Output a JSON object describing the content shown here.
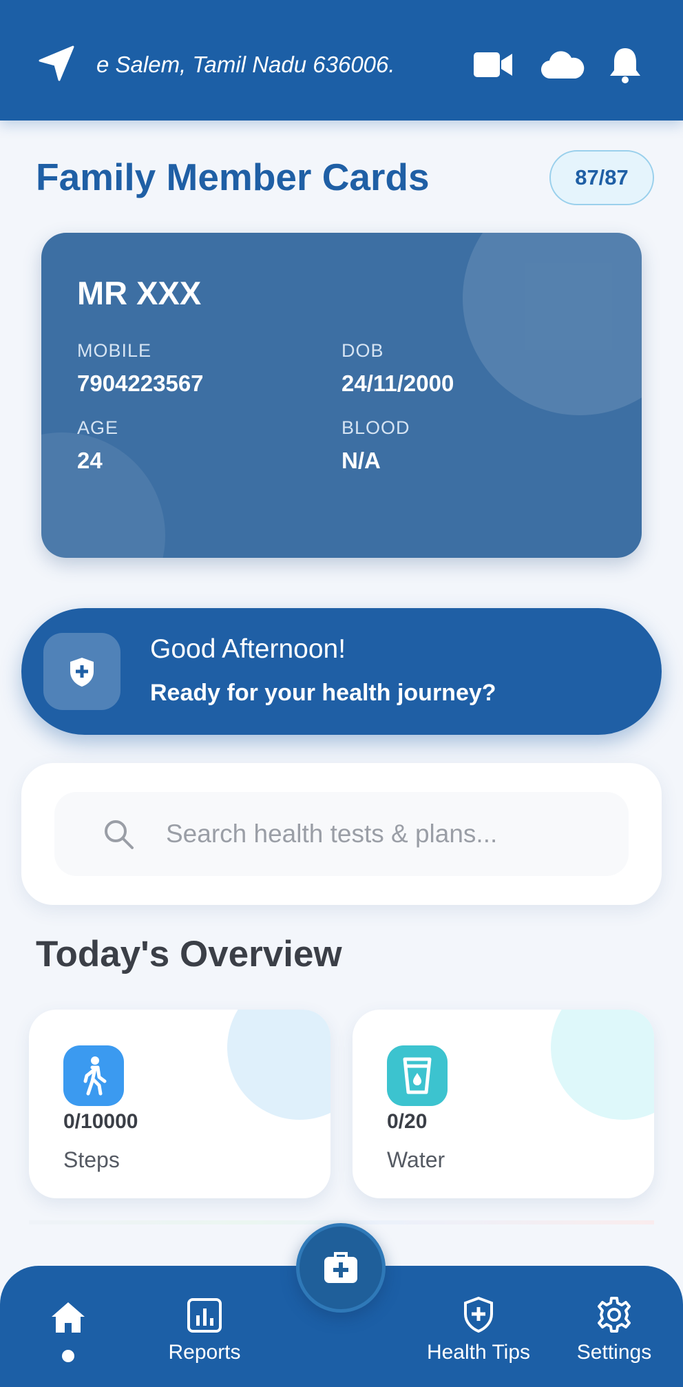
{
  "header": {
    "location": "e  Salem, Tamil Nadu 636006.",
    "icons": [
      "navigation-arrow-icon",
      "video-camera-icon",
      "cloud-icon",
      "bell-icon"
    ]
  },
  "family_section": {
    "title": "Family Member Cards",
    "count_badge": "87/87"
  },
  "member_card": {
    "name": "MR XXX",
    "mobile_label": "MOBILE",
    "mobile_value": "7904223567",
    "dob_label": "DOB",
    "dob_value": "24/11/2000",
    "age_label": "AGE",
    "age_value": "24",
    "blood_label": "BLOOD",
    "blood_value": "N/A"
  },
  "greeting": {
    "title": "Good Afternoon!",
    "subtitle": "Ready for your health journey?"
  },
  "search": {
    "placeholder": "Search health tests & plans..."
  },
  "overview": {
    "title": "Today's Overview",
    "cards": [
      {
        "value": "0/10000",
        "label": "Steps",
        "icon": "walking-person-icon",
        "icon_color": "#3b9af0",
        "deco_color": "#dff0fb"
      },
      {
        "value": "0/20",
        "label": "Water",
        "icon": "water-glass-icon",
        "icon_color": "#3cc3cf",
        "deco_color": "#def8fa"
      }
    ]
  },
  "bottom_nav": {
    "items": [
      {
        "label": "",
        "icon": "home-icon"
      },
      {
        "label": "Reports",
        "icon": "bar-chart-icon"
      },
      {
        "label": "Health Tips",
        "icon": "shield-plus-icon"
      },
      {
        "label": "Settings",
        "icon": "gear-icon"
      }
    ],
    "fab_icon": "medical-kit-icon"
  },
  "colors": {
    "primary": "#1c5fa6",
    "card": "#3d6fa3",
    "background": "#f3f6fb"
  }
}
